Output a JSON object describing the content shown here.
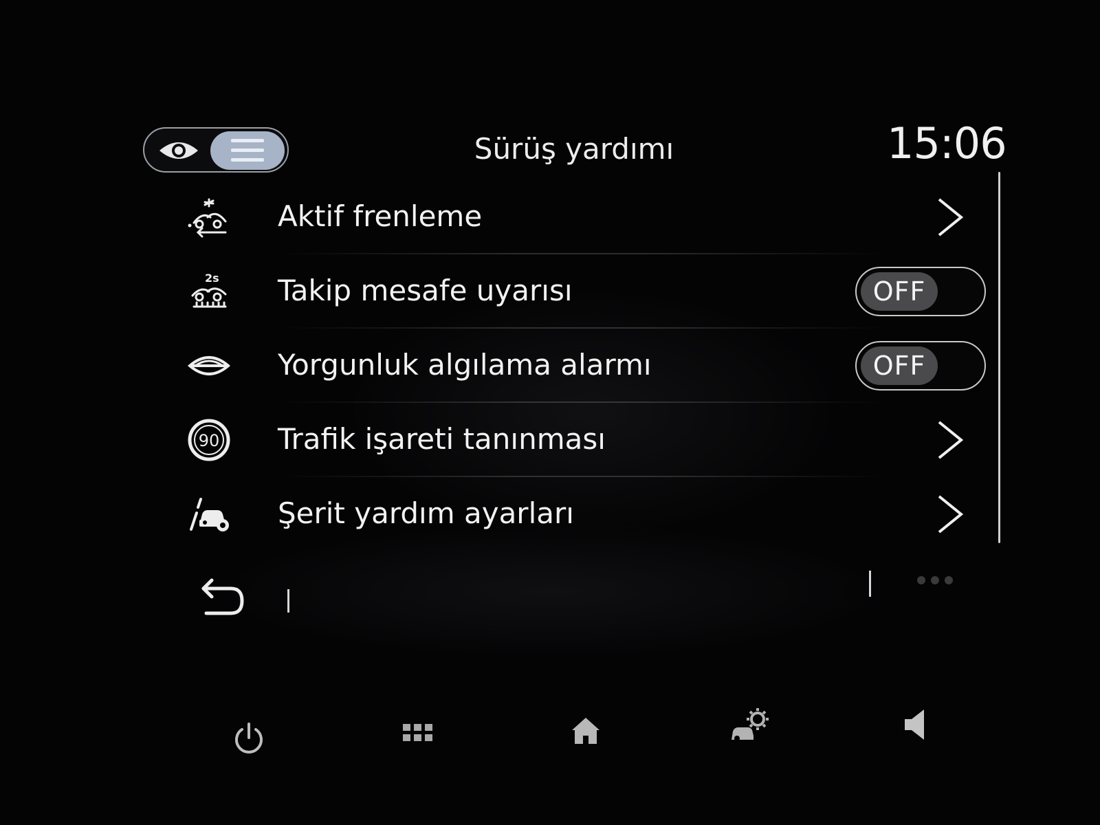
{
  "header": {
    "title": "Sürüş yardımı",
    "clock": "15:06",
    "view_toggle": {
      "options": [
        "eye-icon",
        "list-icon"
      ],
      "selected": "list-icon"
    }
  },
  "menu": {
    "items": [
      {
        "label": "Aktif frenleme",
        "icon": "active-braking-icon",
        "control": "chevron"
      },
      {
        "label": "Takip mesafe uyarısı",
        "icon": "distance-warning-icon",
        "control": "switch",
        "state": "OFF"
      },
      {
        "label": "Yorgunluk algılama alarmı",
        "icon": "fatigue-eye-icon",
        "control": "switch",
        "state": "OFF"
      },
      {
        "label": "Trafik işareti tanınması",
        "icon": "speed-sign-icon",
        "icon_text": "90",
        "control": "chevron"
      },
      {
        "label": "Şerit yardım ayarları",
        "icon": "lane-assist-icon",
        "control": "chevron"
      }
    ]
  },
  "footer": {
    "back_icon": "back-arrow-icon",
    "more_icon": "more-dots-icon"
  },
  "bottom_bar": {
    "buttons": [
      "power-icon",
      "apps-grid-icon",
      "home-icon",
      "car-settings-icon",
      "volume-icon"
    ]
  },
  "colors": {
    "background": "#040405",
    "text": "#f2f2f2",
    "toggle_selected": "#a7b3c6",
    "switch_knob": "#4a4a4c"
  }
}
